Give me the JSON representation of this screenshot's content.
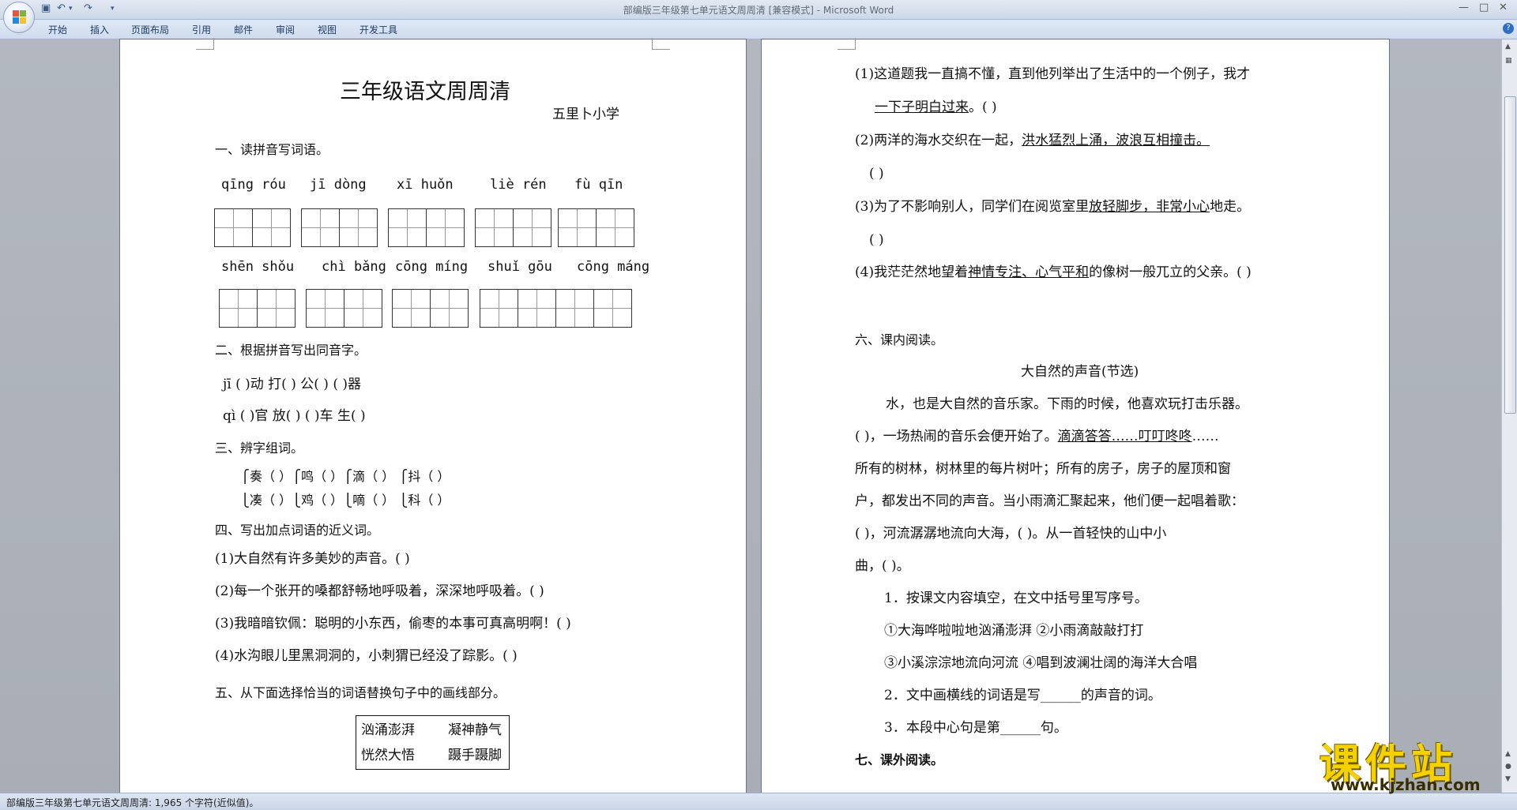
{
  "window": {
    "title": "部编版三年级第七单元语文周周清 [兼容模式] - Microsoft Word",
    "controls": [
      "—",
      "□",
      "✕"
    ]
  },
  "ribbon": {
    "tabs": [
      "开始",
      "插入",
      "页面布局",
      "引用",
      "邮件",
      "审阅",
      "视图",
      "开发工具"
    ]
  },
  "status": {
    "text": "部编版三年级第七单元语文周周清: 1,965 个字符(近似值)。"
  },
  "page1": {
    "title": "三年级语文周周清",
    "school": "五里卜小学",
    "sec1": "一、读拼音写词语。",
    "pinyin_row1": [
      "qīng róu",
      "jī dòng",
      "xī huǒn",
      "liè rén",
      "fù qīn"
    ],
    "pinyin_row2": [
      "shēn  shǒu",
      "chì bǎng",
      "cōng míng",
      "shuǐ gōu",
      "cōng máng"
    ],
    "sec2": "二、根据拼音写出同音字。",
    "homophone1": "jī  (        )动        打(       )   公(        )     (        )器",
    "homophone2": "qì  (        )官        放(       )    (        )车      生(        )",
    "sec3": "三、辨字组词。",
    "distinguish1": "⎧奏（        ）⎧鸣（        ）⎧滴（        ）  ⎧抖（        ）",
    "distinguish2": "⎩凑（        ）⎩鸡（        ）⎩嘀（        ）  ⎩科（        ）",
    "sec4": "四、写出加点词语的近义词。",
    "q4_1": "(1)大自然有许多美妙的声音。(          )",
    "q4_2": "(2)每一个张开的嗓都舒畅地呼吸着，深深地呼吸着。(          )",
    "q4_3": "(3)我暗暗钦佩：聪明的小东西，偷枣的本事可真高明啊！(          )",
    "q4_4": "(4)水沟眼儿里黑洞洞的，小刺猬已经没了踪影。(          )",
    "sec5": "五、从下面选择恰当的词语替换句子中的画线部分。",
    "words": [
      "汹涌澎湃",
      "凝神静气",
      "恍然大悟",
      "蹑手蹑脚"
    ]
  },
  "page2": {
    "q5_1a": "(1)这道题我一直搞不懂，直到他列举出了生活中的一个例子，我才",
    "q5_1b_ul": "一下子明白过来",
    "q5_1b_rest": "。(              )",
    "q5_2a": "(2)两洋的海水交织在一起，",
    "q5_2a_ul": "洪水猛烈上涌，波浪互相撞击。",
    "q5_2b": "(          )",
    "q5_3_pre": "(3)为了不影响别人，同学们在阅览室里",
    "q5_3_ul": "放轻脚步，非常小心",
    "q5_3_post": "地走。",
    "q5_3b": "(   )",
    "q5_4_pre": "(4)我茫茫然地望着",
    "q5_4_ul": "神情专注、心气平和",
    "q5_4_post": "的像树一般兀立的父亲。(   )",
    "sec6": "六、课内阅读。",
    "reading_title": "大自然的声音(节选)",
    "r1": "水，也是大自然的音乐家。下雨的时候，他喜欢玩打击乐器。",
    "r2_pre": "(          )，一场热闹的音乐会便开始了。",
    "r2_ul": "滴滴答答……叮叮咚咚",
    "r2_post": "……",
    "r3": "所有的树林，树林里的每片树叶；所有的房子，房子的屋顶和窗",
    "r4": "户，都发出不同的声音。当小雨滴汇聚起来，他们便一起唱着歌：",
    "r5": "(          )，河流潺潺地流向大海，(          )。从一首轻快的山中小",
    "r6": "曲，(          )。",
    "t1": "1．按课文内容填空，在文中括号里写序号。",
    "t1_opts1": "①大海哗啦啦地汹涌澎湃   ②小雨滴敲敲打打",
    "t1_opts2": "③小溪淙淙地流向河流   ④唱到波澜壮阔的海洋大合唱",
    "t2": "2．文中画横线的词语是写______的声音的词。",
    "t3": "3．本段中心句是第______句。",
    "sec7": "七、课外阅读。"
  },
  "watermark": {
    "main": "课件站",
    "sub": "www.kjzhan.com"
  }
}
